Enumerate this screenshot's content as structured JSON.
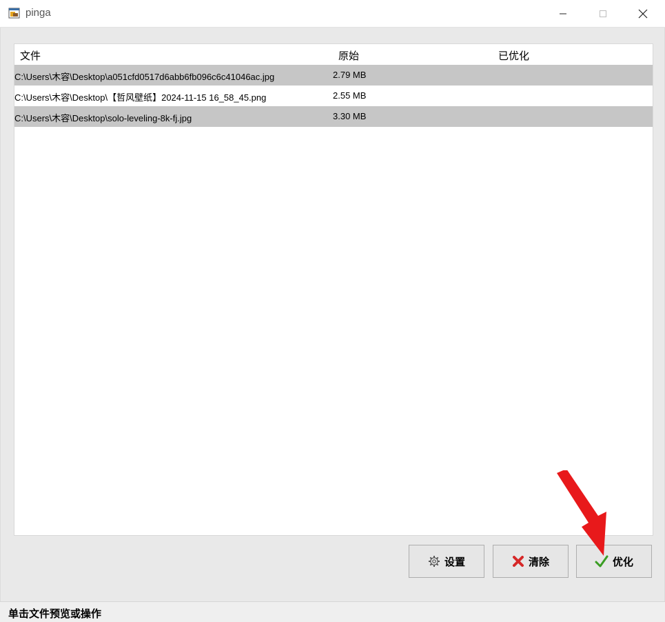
{
  "window": {
    "title": "pinga",
    "icon": "app-window-icon",
    "controls": {
      "minimize": "minimize-icon",
      "maximize": "maximize-icon",
      "close": "close-icon"
    }
  },
  "table": {
    "columns": [
      "文件",
      "原始",
      "已优化"
    ],
    "rows": [
      {
        "path": "C:\\Users\\木容\\Desktop\\a051cfd0517d6abb6fb096c6c41046ac.jpg",
        "original": "2.79 MB",
        "optimized": ""
      },
      {
        "path": "C:\\Users\\木容\\Desktop\\【哲风壁纸】2024-11-15 16_58_45.png",
        "original": "2.55 MB",
        "optimized": ""
      },
      {
        "path": "C:\\Users\\木容\\Desktop\\solo-leveling-8k-fj.jpg",
        "original": "3.30 MB",
        "optimized": ""
      }
    ]
  },
  "buttons": {
    "settings": {
      "label": "设置",
      "icon": "gear-icon"
    },
    "clear": {
      "label": "清除",
      "icon": "red-x-icon"
    },
    "optimize": {
      "label": "优化",
      "icon": "green-check-icon"
    }
  },
  "annotation": {
    "icon": "red-arrow-icon",
    "color": "#e8191b"
  },
  "status": {
    "text": "单击文件预览或操作"
  }
}
